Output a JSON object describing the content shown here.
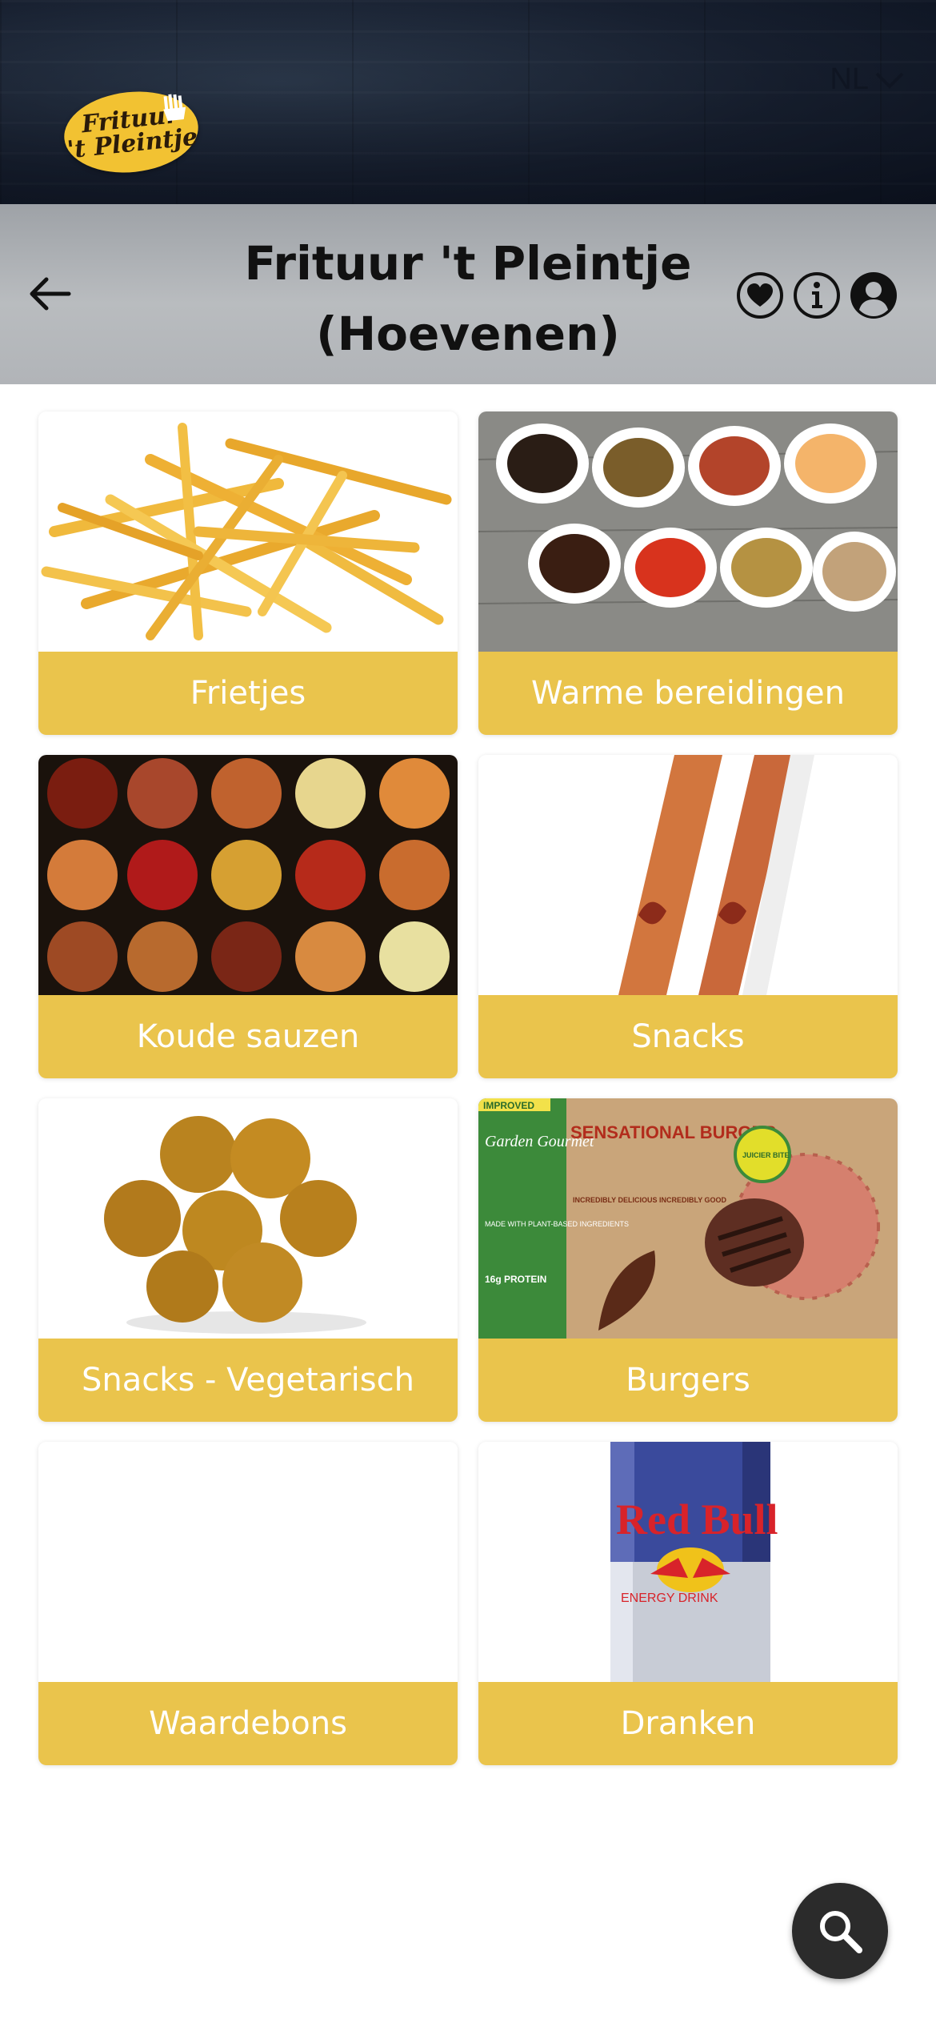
{
  "banner": {
    "logo_line1": "Frituur",
    "logo_line2": "'t Pleintje",
    "language": "NL"
  },
  "header": {
    "title_line1": "Frituur 't Pleintje",
    "title_line2": "(Hoevenen)"
  },
  "icons": {
    "back": "arrow-left-icon",
    "favorite": "heart-icon",
    "info": "info-icon",
    "account": "user-icon",
    "search": "search-icon"
  },
  "categories": [
    {
      "label": "Frietjes"
    },
    {
      "label": "Warme bereidingen"
    },
    {
      "label": "Koude sauzen"
    },
    {
      "label": "Snacks"
    },
    {
      "label": "Snacks - Vegetarisch"
    },
    {
      "label": "Burgers"
    },
    {
      "label": "Waardebons"
    },
    {
      "label": "Dranken"
    }
  ],
  "product_images": {
    "burger_pack_brand": "Garden Gourmet",
    "burger_pack_title": "SENSATIONAL BURGER",
    "burger_pack_tag": "IMPROVED",
    "burger_pack_badge": "JUICIER BITE",
    "burger_pack_claim": "MADE WITH PLANT-BASED INGREDIENTS",
    "burger_pack_claim2": "INCREDIBLY DELICIOUS INCREDIBLY GOOD",
    "burger_pack_protein": "16g PROTEIN",
    "drink_can_brand": "Red Bull",
    "drink_can_sub": "ENERGY DRINK"
  },
  "colors": {
    "accent": "#eac44c",
    "header_bg": "#b4b7bb",
    "fab_bg": "#2b2b2b"
  }
}
